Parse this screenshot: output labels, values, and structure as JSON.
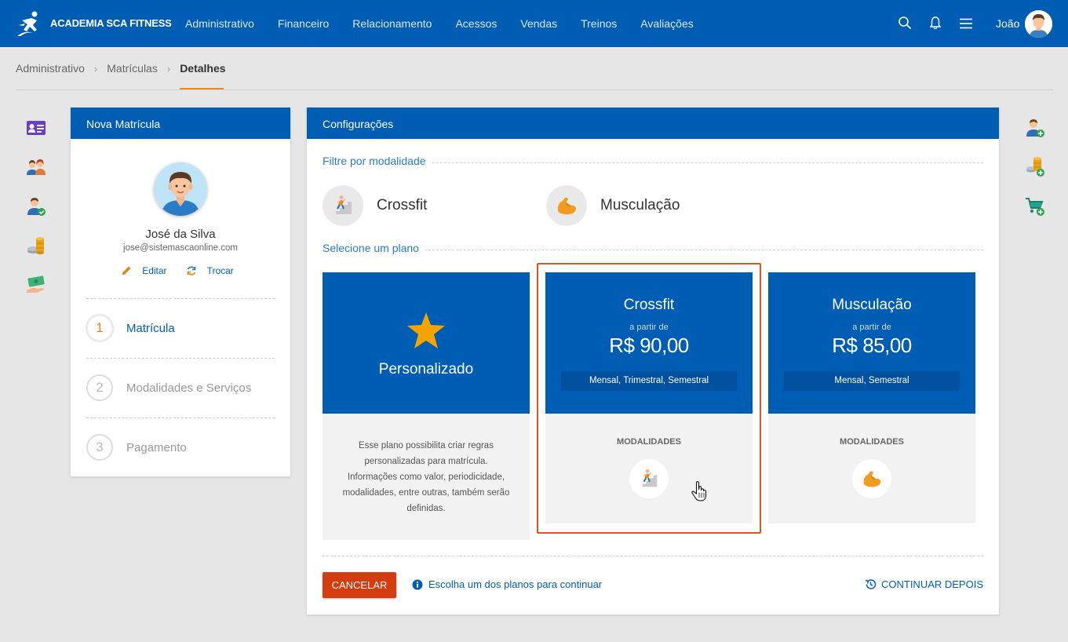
{
  "app": {
    "brand": "ACADEMIA SCA FITNESS",
    "nav": [
      "Administrativo",
      "Financeiro",
      "Relacionamento",
      "Acessos",
      "Vendas",
      "Treinos",
      "Avaliações"
    ],
    "user_name": "João",
    "icons": [
      "search-icon",
      "bell-icon",
      "menu-icon"
    ]
  },
  "breadcrumb": {
    "items": [
      "Administrativo",
      "Matrículas"
    ],
    "current": "Detalhes",
    "accent": "#e68a1e"
  },
  "left_sidebar_icons": [
    "id-card-icon",
    "people-icon",
    "user-check-icon",
    "coins-icon",
    "money-hand-icon"
  ],
  "right_sidebar_icons": [
    "add-user-icon",
    "add-coins-icon",
    "add-cart-icon"
  ],
  "enrollment": {
    "title": "Nova Matrícula",
    "person_name": "José da Silva",
    "email": "jose@sistemascaonline.com",
    "edit_label": "Editar",
    "swap_label": "Trocar",
    "steps": [
      {
        "num": "1",
        "label": "Matrícula",
        "active": true
      },
      {
        "num": "2",
        "label": "Modalidades e Serviços",
        "active": false
      },
      {
        "num": "3",
        "label": "Pagamento",
        "active": false
      }
    ]
  },
  "config": {
    "title": "Configurações",
    "filter_title": "Filtre por modalidade",
    "modalities": [
      {
        "label": "Crossfit",
        "icon": "crossfit-icon"
      },
      {
        "label": "Musculação",
        "icon": "muscle-icon"
      }
    ],
    "plan_title": "Selecione um plano",
    "custom_plan": {
      "name": "Personalizado",
      "description": "Esse plano possibilita criar regras personalizadas para matrícula. Informações como valor, periodicidade, modalidades, entre outras, também serão definidas."
    },
    "plans": [
      {
        "name": "Crossfit",
        "from": "a partir de",
        "price": "R$ 90,00",
        "periods": "Mensal, Trimestral, Semestral",
        "mod_title": "MODALIDADES",
        "icon": "crossfit-icon",
        "selected": true
      },
      {
        "name": "Musculação",
        "from": "a partir de",
        "price": "R$ 85,00",
        "periods": "Mensal, Semestral",
        "mod_title": "MODALIDADES",
        "icon": "muscle-icon",
        "selected": false
      }
    ],
    "cancel_label": "CANCELAR",
    "hint": "Escolha um dos planos para continuar",
    "continue_label": "CONTINUAR DEPOIS",
    "colors": {
      "primary": "#005db4",
      "cancel": "#d33c0e",
      "selection": "#e0541e"
    }
  }
}
